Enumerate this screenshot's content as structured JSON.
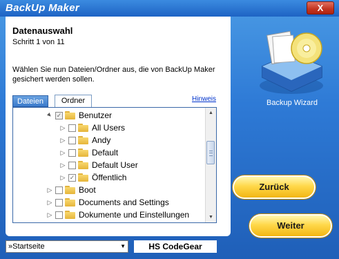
{
  "window": {
    "title": "BackUp Maker",
    "close_label": "X"
  },
  "panel": {
    "heading": "Datenauswahl",
    "step": "Schritt 1 von 11",
    "description": "Wählen Sie nun Dateien/Ordner aus, die von BackUp Maker gesichert werden sollen."
  },
  "tabs": [
    {
      "label": "Dateien",
      "active": false
    },
    {
      "label": "Ordner",
      "active": true
    }
  ],
  "hint_link": "Hinweis",
  "tree": [
    {
      "label": "Benutzer",
      "level": 1,
      "expander": "▲",
      "checked": true,
      "dimmed": true
    },
    {
      "label": "All Users",
      "level": 2,
      "expander": "▷",
      "checked": false
    },
    {
      "label": "Andy",
      "level": 2,
      "expander": "▷",
      "checked": false
    },
    {
      "label": "Default",
      "level": 2,
      "expander": "▷",
      "checked": false
    },
    {
      "label": "Default User",
      "level": 2,
      "expander": "▷",
      "checked": false
    },
    {
      "label": "Öffentlich",
      "level": 2,
      "expander": "▷",
      "checked": true
    },
    {
      "label": "Boot",
      "level": 0,
      "expander": "▷",
      "checked": false
    },
    {
      "label": "Documents and Settings",
      "level": 0,
      "expander": "▷",
      "checked": false
    },
    {
      "label": "Dokumente und Einstellungen",
      "level": 0,
      "expander": "▷",
      "checked": false
    }
  ],
  "wizard": {
    "label": "Backup Wizard",
    "icon": "backup-drive-icon"
  },
  "buttons": {
    "back": "Zurück",
    "next": "Weiter"
  },
  "footer": {
    "select_value": "»Startseite",
    "brand": "HS CodeGear"
  },
  "colors": {
    "accent_yellow": "#ffd84a",
    "window_blue": "#2e7ad6",
    "close_red": "#c23420"
  }
}
